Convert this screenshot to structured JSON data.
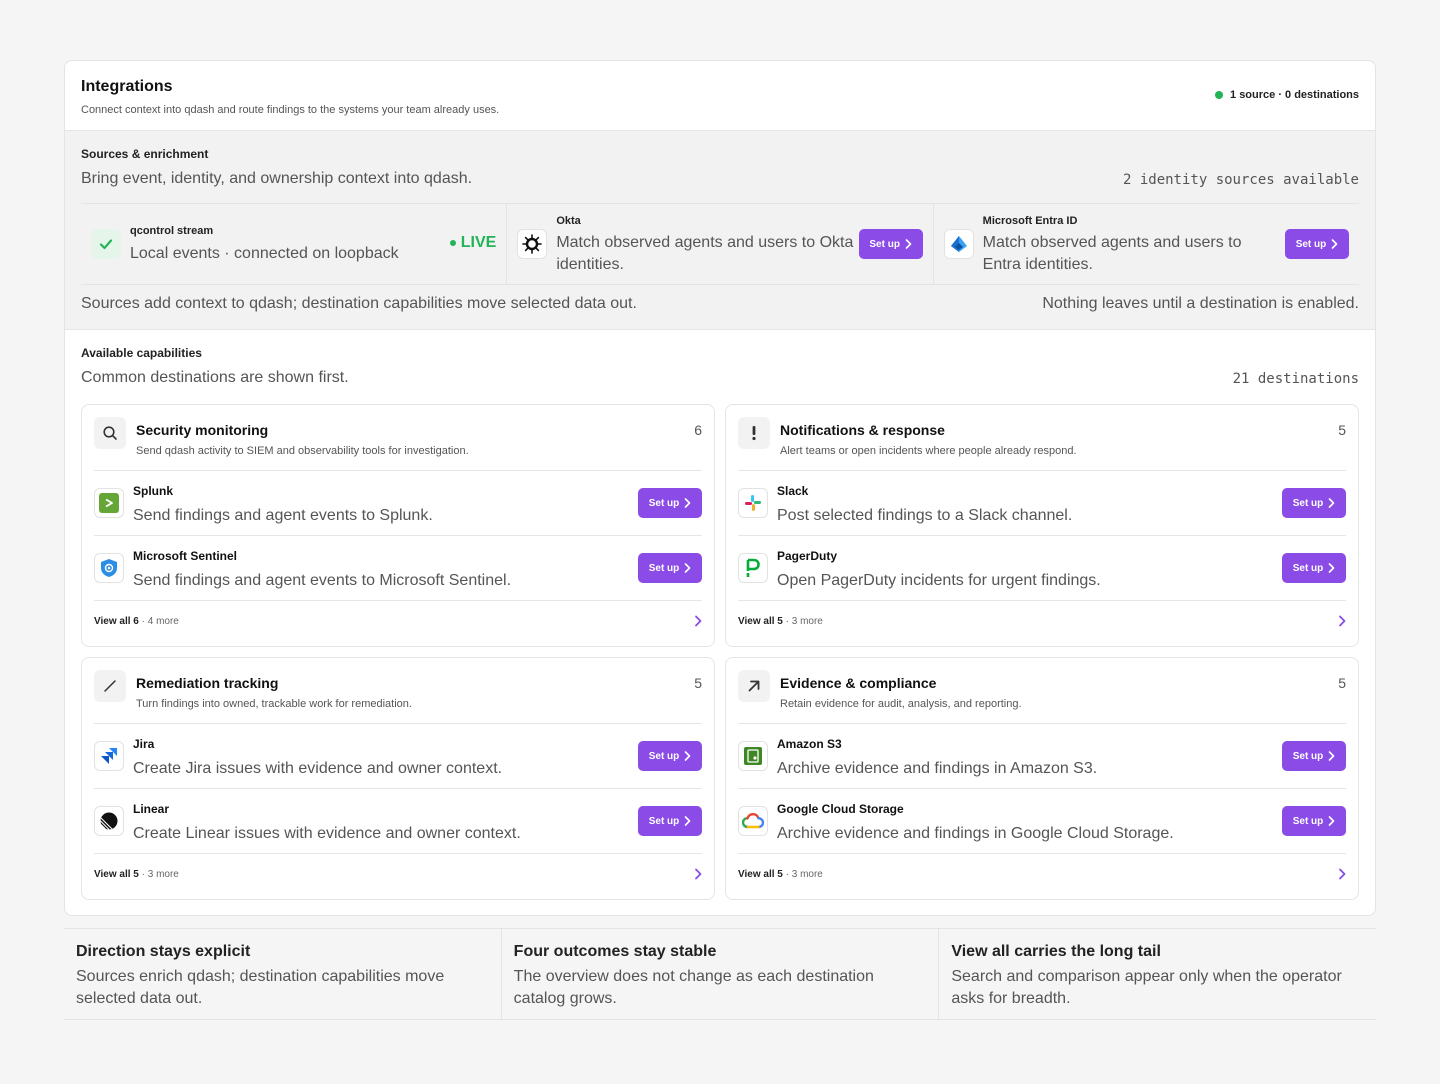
{
  "header": {
    "title": "Integrations",
    "subtitle": "Connect context into qdash and route findings to the systems your team already uses.",
    "status": "1 source · 0 destinations"
  },
  "sources": {
    "title": "Sources & enrichment",
    "subtitle": "Bring event, identity, and ownership context into qdash.",
    "available": "2 identity sources available",
    "items": [
      {
        "name": "qcontrol stream",
        "desc": "Local events · connected on loopback",
        "badge": "LIVE",
        "icon": "check-icon"
      },
      {
        "name": "Okta",
        "desc": "Match observed agents and users to Okta identities.",
        "button": "Set up",
        "icon": "okta-logo-icon"
      },
      {
        "name": "Microsoft Entra ID",
        "desc": "Match observed agents and users to Entra identities.",
        "button": "Set up",
        "icon": "entra-logo-icon"
      }
    ],
    "footer_left": "Sources add context to qdash; destination capabilities move selected data out.",
    "footer_right": "Nothing leaves until a destination is enabled."
  },
  "capabilities": {
    "title": "Available capabilities",
    "subtitle": "Common destinations are shown first.",
    "count": "21 destinations",
    "cards": [
      {
        "title": "Security monitoring",
        "subtitle": "Send qdash activity to SIEM and observability tools for investigation.",
        "count": "6",
        "items": [
          {
            "name": "Splunk",
            "desc": "Send findings and agent events to Splunk.",
            "button": "Set up"
          },
          {
            "name": "Microsoft Sentinel",
            "desc": "Send findings and agent events to Microsoft Sentinel.",
            "button": "Set up"
          }
        ],
        "view_all": "View all 6",
        "more": "· 4 more"
      },
      {
        "title": "Notifications & response",
        "subtitle": "Alert teams or open incidents where people already respond.",
        "count": "5",
        "items": [
          {
            "name": "Slack",
            "desc": "Post selected findings to a Slack channel.",
            "button": "Set up"
          },
          {
            "name": "PagerDuty",
            "desc": "Open PagerDuty incidents for urgent findings.",
            "button": "Set up"
          }
        ],
        "view_all": "View all 5",
        "more": "· 3 more"
      },
      {
        "title": "Remediation tracking",
        "subtitle": "Turn findings into owned, trackable work for remediation.",
        "count": "5",
        "items": [
          {
            "name": "Jira",
            "desc": "Create Jira issues with evidence and owner context.",
            "button": "Set up"
          },
          {
            "name": "Linear",
            "desc": "Create Linear issues with evidence and owner context.",
            "button": "Set up"
          }
        ],
        "view_all": "View all 5",
        "more": "· 3 more"
      },
      {
        "title": "Evidence & compliance",
        "subtitle": "Retain evidence for audit, analysis, and reporting.",
        "count": "5",
        "items": [
          {
            "name": "Amazon S3",
            "desc": "Archive evidence and findings in Amazon S3.",
            "button": "Set up"
          },
          {
            "name": "Google Cloud Storage",
            "desc": "Archive evidence and findings in Google Cloud Storage.",
            "button": "Set up"
          }
        ],
        "view_all": "View all 5",
        "more": "· 3 more"
      }
    ]
  },
  "outcomes": [
    {
      "title": "Direction stays explicit",
      "desc": "Sources enrich qdash; destination capabilities move selected data out."
    },
    {
      "title": "Four outcomes stay stable",
      "desc": "The overview does not change as each destination catalog grows."
    },
    {
      "title": "View all carries the long tail",
      "desc": "Search and comparison appear only when the operator asks for breadth."
    }
  ],
  "colors": {
    "accent": "#8a4be6",
    "live": "#22b457"
  }
}
